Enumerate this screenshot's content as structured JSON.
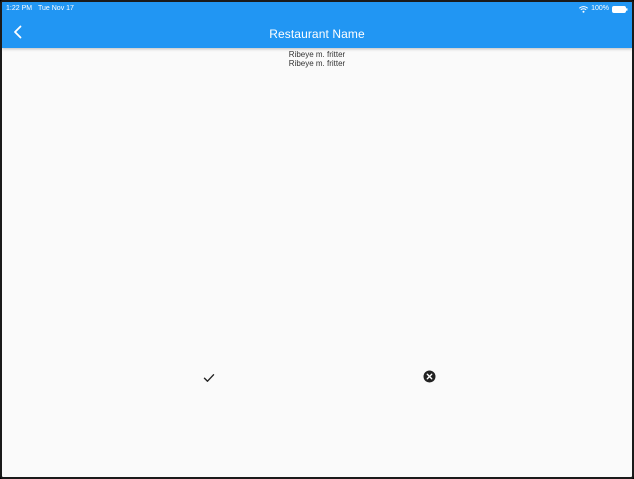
{
  "status_bar": {
    "time": "1:22 PM",
    "date": "Tue Nov 17",
    "battery": "100%"
  },
  "app_bar": {
    "title": "Restaurant Name",
    "back_icon": "chevron-left-icon",
    "color": "#2196f3"
  },
  "content": {
    "lines": [
      "Ribeye m. fritter",
      "Ribeye m. fritter"
    ]
  },
  "actions": {
    "confirm_icon": "check-icon",
    "cancel_icon": "cancel-circle-icon"
  }
}
